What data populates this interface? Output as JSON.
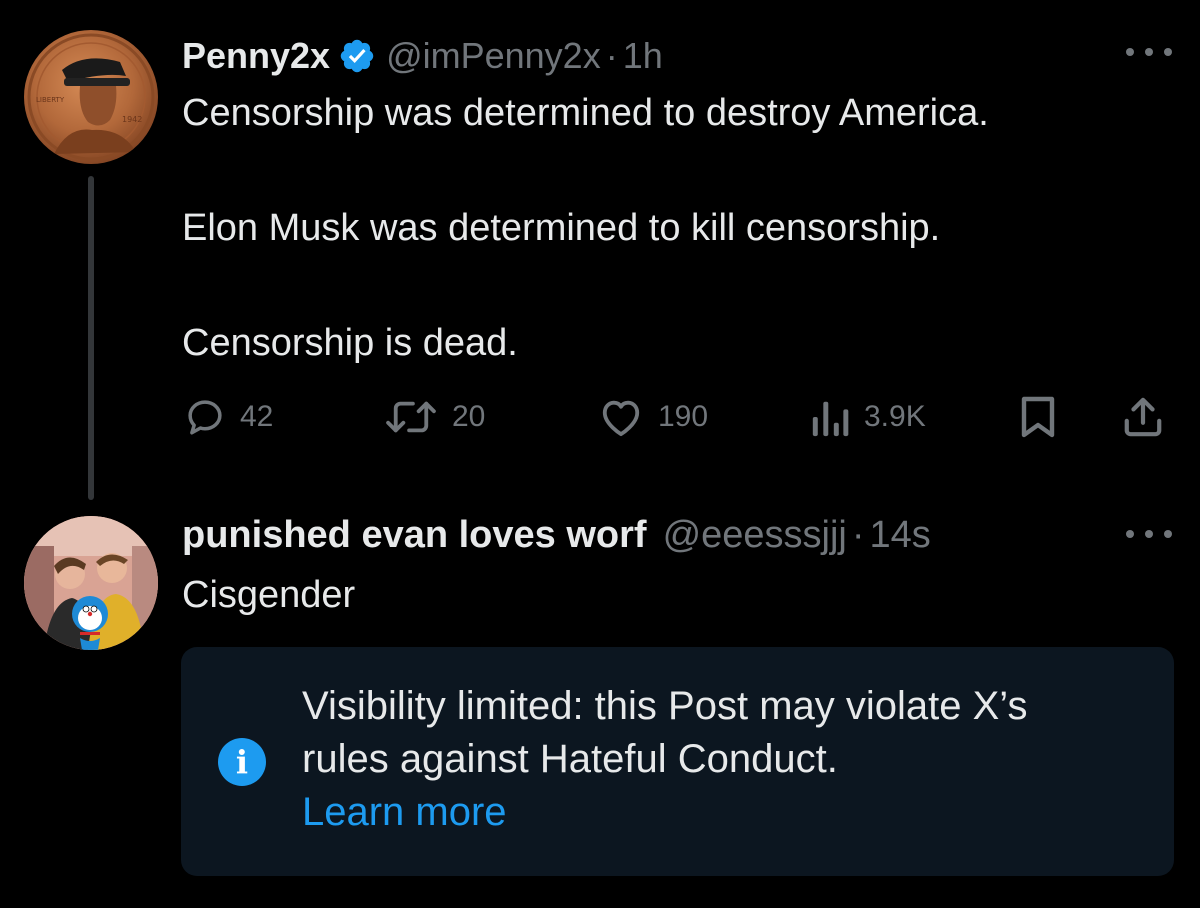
{
  "post1": {
    "display_name": "Penny2x",
    "handle": "@imPenny2x",
    "separator": "·",
    "time": "1h",
    "text_lines": [
      "Censorship was determined to destroy America.",
      "Elon Musk was determined to kill censorship.",
      "Censorship is dead."
    ],
    "stats": {
      "replies": "42",
      "reposts": "20",
      "likes": "190",
      "views": "3.9K"
    }
  },
  "post2": {
    "display_name": "punished evan loves worf",
    "handle": "@eeesssjjj",
    "separator": "·",
    "time": "14s",
    "text": "Cisgender",
    "notice": {
      "line1": "Visibility limited: this Post may violate X’s",
      "line2": "rules against Hateful Conduct.",
      "link": "Learn more"
    }
  },
  "colors": {
    "background": "#000000",
    "primary_text": "#e7e9ea",
    "secondary_text": "#71767b",
    "accent": "#1d9bf0",
    "notice_background": "#0c1620"
  },
  "icons": [
    "verified-badge-icon",
    "more-icon",
    "reply-icon",
    "repost-icon",
    "like-icon",
    "views-icon",
    "bookmark-icon",
    "share-icon",
    "info-icon"
  ]
}
